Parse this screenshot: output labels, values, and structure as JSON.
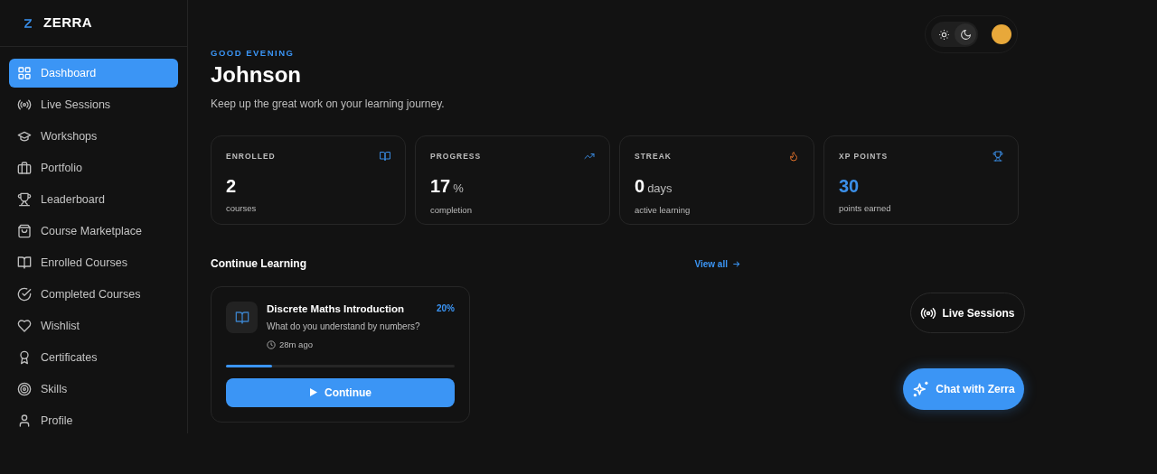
{
  "brand": {
    "name": "ZERRA"
  },
  "sidebar": {
    "items": [
      {
        "label": "Dashboard",
        "selected": true
      },
      {
        "label": "Live Sessions",
        "selected": false
      },
      {
        "label": "Workshops",
        "selected": false
      },
      {
        "label": "Portfolio",
        "selected": false
      },
      {
        "label": "Leaderboard",
        "selected": false
      },
      {
        "label": "Course Marketplace",
        "selected": false
      },
      {
        "label": "Enrolled Courses",
        "selected": false
      },
      {
        "label": "Completed Courses",
        "selected": false
      },
      {
        "label": "Wishlist",
        "selected": false
      },
      {
        "label": "Certificates",
        "selected": false
      },
      {
        "label": "Skills",
        "selected": false
      },
      {
        "label": "Profile",
        "selected": false
      }
    ]
  },
  "header": {
    "dark_mode": true,
    "greeting": "GOOD EVENING",
    "name": "Johnson",
    "subtitle": "Keep up the great work on your learning journey."
  },
  "stats": [
    {
      "label": "ENROLLED",
      "value": "2",
      "caption": "courses"
    },
    {
      "label": "PROGRESS",
      "value": "17",
      "unit": "%",
      "caption": "completion"
    },
    {
      "label": "STREAK",
      "value": "0",
      "unit": "days",
      "caption": "active learning"
    },
    {
      "label": "XP POINTS",
      "value": "30",
      "caption": "points earned"
    }
  ],
  "continue_learning": {
    "title": "Continue Learning",
    "view_all": "View all",
    "courses": [
      {
        "title": "Discrete Maths Introduction",
        "lesson": "What do you understand by numbers?",
        "time": "28m ago",
        "percent": "20%",
        "level": 0.2,
        "button": "Continue"
      }
    ]
  },
  "floating": {
    "live": "Live Sessions",
    "chat": "Chat with Zerra"
  }
}
